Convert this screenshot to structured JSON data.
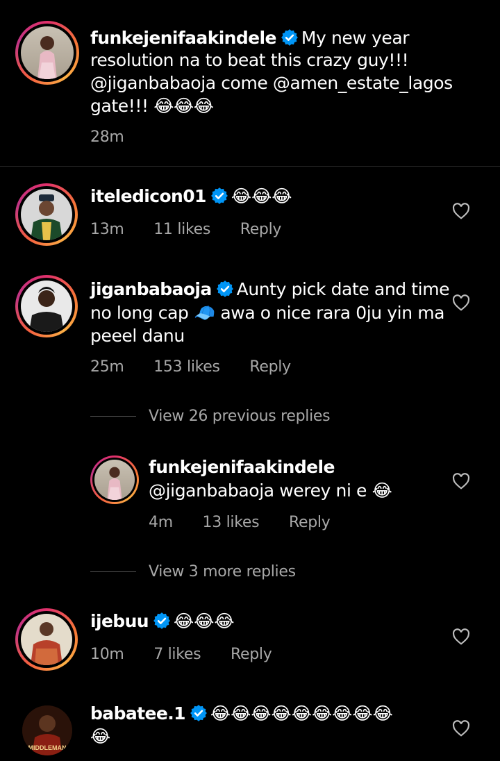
{
  "post_caption": {
    "username": "funkejenifaakindele",
    "text_1": "My new year",
    "text_2": "resolution na to beat this crazy guy!!!",
    "text_3": "@jiganbabaoja  come @amen_estate_lagos",
    "text_4": "gate!!!",
    "emojis": "😂😂😂",
    "time": "28m"
  },
  "comments": [
    {
      "username": "iteledicon01",
      "emojis": "😂😂😂",
      "time": "13m",
      "likes": "11 likes",
      "reply": "Reply"
    },
    {
      "username": "jiganbabaoja",
      "text_1": "Aunty pick date and time",
      "text_2a": "no long cap",
      "cap_emoji": "🧢",
      "text_2b": "awa o nice rara 0ju yin ma",
      "text_3": "peeel danu",
      "time": "25m",
      "likes": "153 likes",
      "reply": "Reply",
      "view_previous": "View 26 previous replies",
      "nested_reply": {
        "username": "funkejenifaakindele",
        "mention": "@jiganbabaoja",
        "text": "werey ni e",
        "emoji": "😂",
        "time": "4m",
        "likes": "13 likes",
        "reply": "Reply"
      },
      "view_more": "View 3 more replies"
    },
    {
      "username": "ijebuu",
      "emojis": "😂😂😂",
      "time": "10m",
      "likes": "7 likes",
      "reply": "Reply"
    },
    {
      "username": "babatee.1",
      "emojis_1": "😂😂😂😂😂😂😂😂😂",
      "emojis_2": "😂",
      "avatar_label": "MIDDLEMAN"
    }
  ],
  "colors": {
    "background": "#000000",
    "text": "#ffffff",
    "meta": "#a8a8a8",
    "mention": "#e0f1ff",
    "verified": "#0095f6"
  },
  "icons": [
    "verified-badge-icon",
    "heart-icon"
  ]
}
